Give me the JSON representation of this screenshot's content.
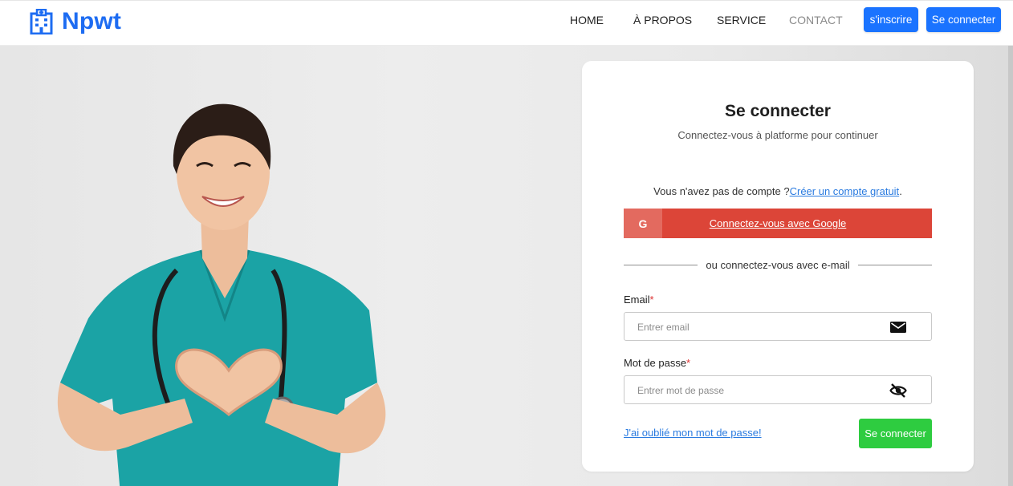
{
  "brand": {
    "name": "Npwt",
    "icon": "hospital-icon",
    "color": "#1d6cf2"
  },
  "nav": {
    "links": [
      "HOME",
      "À PROPOS",
      "SERVICE",
      "CONTACT"
    ],
    "signup_label": "s'inscrire",
    "login_label": "Se connecter"
  },
  "login": {
    "title": "Se connecter",
    "subtitle": "Connectez-vous à platforme pour continuer",
    "no_account_text": "Vous n'avez pas de compte ?",
    "create_account_link": "Créer un compte gratuit",
    "create_account_suffix": ".",
    "google_letter": "G",
    "google_label": "Connectez-vous avec Google",
    "divider_text": "ou connectez-vous avec e-mail",
    "email_label": "Email",
    "email_placeholder": "Entrer email",
    "email_icon": "envelope-icon",
    "password_label": "Mot de passe",
    "password_placeholder": "Entrer mot de passe",
    "password_icon": "eye-slash-icon",
    "required_mark": "*",
    "forgot_label": "J'ai oublié mon mot de passe!",
    "submit_label": "Se connecter"
  },
  "colors": {
    "primary": "#1a73ff",
    "google": "#dc4538",
    "submit": "#2ecc40",
    "link": "#2a7be0"
  }
}
